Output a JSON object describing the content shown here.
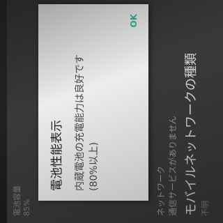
{
  "background": {
    "item_battery_capacity": "電池容量",
    "item_battery_capacity_sub": "85%",
    "item_network": "ネットワーク",
    "item_network_status": "通信サービスがありません",
    "item_mobile_network_type": "モバイルネットワークの種類",
    "item_mobile_network_type_sub": "不明"
  },
  "dialog": {
    "title": "電池性能表示",
    "message_line1": "内蔵電池の充電能力は良好です",
    "message_line2": "(80%以上)",
    "ok_label": "OK"
  },
  "colors": {
    "dialog_background": "#ededed",
    "accent": "#2ab9a6",
    "settings_background": "#3a3a3a"
  }
}
